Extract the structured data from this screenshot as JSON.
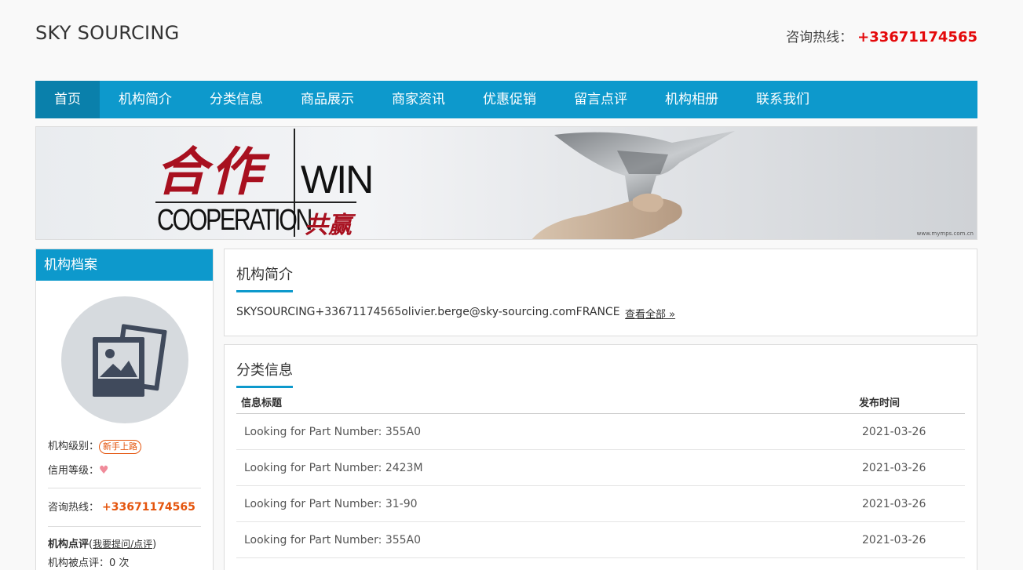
{
  "header": {
    "brand": "SKY SOURCING",
    "hotline_label": "咨询热线：",
    "hotline_number": "+33671174565"
  },
  "nav": {
    "items": [
      "首页",
      "机构简介",
      "分类信息",
      "商品展示",
      "商家资讯",
      "优惠促销",
      "留言点评",
      "机构相册",
      "联系我们"
    ],
    "active_index": 0
  },
  "banner": {
    "cn_main": "合作",
    "en_win": "WIN",
    "en_coop": "COOPERATION",
    "cn_sub": "共赢",
    "site": "www.mymps.com.cn"
  },
  "sidebar": {
    "title": "机构档案",
    "level_label": "机构级别：",
    "level_badge": "新手上路",
    "credit_label": "信用等级：",
    "hotline_label": "咨询热线：",
    "hotline_number": "+33671174565",
    "review_label": "机构点评",
    "review_link": "我要提问/点评",
    "reviewed_label": "机构被点评：0 次"
  },
  "intro": {
    "title": "机构简介",
    "text": "SKYSOURCING+33671174565olivier.berge@sky-sourcing.comFRANCE",
    "more": "查看全部 »"
  },
  "listings": {
    "title": "分类信息",
    "col_title": "信息标题",
    "col_time": "发布时间",
    "rows": [
      {
        "title": "Looking for Part Number: 355A0",
        "date": "2021-03-26"
      },
      {
        "title": "Looking for Part Number: 2423M",
        "date": "2021-03-26"
      },
      {
        "title": "Looking for Part Number: 31-90",
        "date": "2021-03-26"
      },
      {
        "title": "Looking for Part Number: 355A0",
        "date": "2021-03-26"
      }
    ]
  },
  "colors": {
    "accent": "#0d99cc",
    "nav_active": "#0a80ab",
    "hotline": "#e4090b",
    "badge": "#e4540c"
  }
}
